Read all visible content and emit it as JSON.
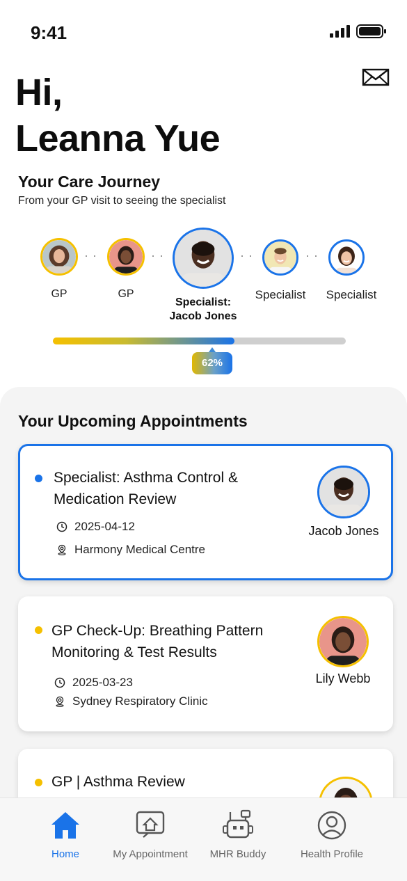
{
  "status_bar": {
    "time": "9:41"
  },
  "header": {
    "greeting_line1": "Hi,",
    "greeting_line2": "Leanna Yue",
    "mail_icon": "mail-icon"
  },
  "care_journey": {
    "title": "Your Care Journey",
    "subtitle": "From your GP visit to seeing the specialist",
    "steps": [
      {
        "label": "GP"
      },
      {
        "label": "GP"
      },
      {
        "label_line1": "Specialist:",
        "label_line2": "Jacob Jones"
      },
      {
        "label": "Specialist"
      },
      {
        "label": "Specialist"
      }
    ],
    "progress_percent": 62,
    "progress_text": "62%"
  },
  "appointments": {
    "title": "Your Upcoming Appointments",
    "items": [
      {
        "title": "Specialist: Asthma Control & Medication Review",
        "date": "2025-04-12",
        "location": "Harmony Medical Centre",
        "person": "Jacob Jones",
        "status_color": "#1a73e8"
      },
      {
        "title": "GP Check-Up: Breathing Pattern Monitoring & Test Results",
        "date": "2025-03-23",
        "location": "Sydney Respiratory Clinic",
        "person": "Lily Webb",
        "status_color": "#f5c000"
      },
      {
        "title": "GP | Asthma Review",
        "status_color": "#f5c000"
      }
    ]
  },
  "nav": {
    "items": [
      {
        "label": "Home",
        "icon": "home-icon",
        "active": true
      },
      {
        "label": "My Appointment",
        "icon": "appointment-icon"
      },
      {
        "label": "MHR Buddy",
        "icon": "robot-icon"
      },
      {
        "label": "Health Profile",
        "icon": "profile-icon"
      }
    ]
  },
  "colors": {
    "accent_blue": "#1a73e8",
    "accent_gold": "#f5c000",
    "panel_bg": "#f4f4f4"
  }
}
